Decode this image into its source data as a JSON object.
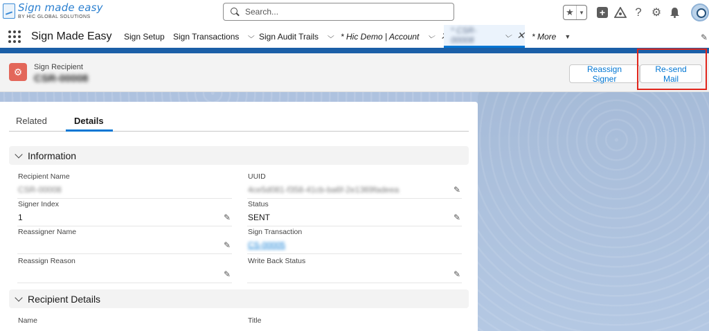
{
  "logo": {
    "title": "Sign made easy",
    "subtitle": "BY HIC GLOBAL SOLUTIONS"
  },
  "search": {
    "placeholder": "Search..."
  },
  "header_icons": [
    "favorites-star-icon",
    "favorites-dropdown-icon",
    "global-actions-plus-icon",
    "trailhead-icon",
    "help-icon",
    "setup-gear-icon",
    "notifications-bell-icon",
    "user-avatar"
  ],
  "nav": {
    "app_name": "Sign Made Easy",
    "items": [
      {
        "label": "Sign Setup"
      },
      {
        "label": "Sign Transactions"
      },
      {
        "label": "Sign Audit Trails"
      },
      {
        "label": "* Hic Demo | Account"
      },
      {
        "label": "* CSR-00008"
      },
      {
        "label": "* More"
      }
    ]
  },
  "record": {
    "type": "Sign Recipient",
    "name": "CSR-00008",
    "buttons": {
      "reassign": "Reassign Signer",
      "resend": "Re-send Mail"
    }
  },
  "tabs": {
    "related": "Related",
    "details": "Details"
  },
  "sections": {
    "information": "Information",
    "recipient_details": "Recipient Details"
  },
  "fields": {
    "recipient_name": {
      "label": "Recipient Name",
      "value": "CSR-00008"
    },
    "uuid": {
      "label": "UUID",
      "value": "4ce5d081-f358-41cb-ba6f-2e1369fadeea"
    },
    "signer_index": {
      "label": "Signer Index",
      "value": "1"
    },
    "status": {
      "label": "Status",
      "value": "SENT"
    },
    "reassigner_name": {
      "label": "Reassigner Name",
      "value": ""
    },
    "sign_transaction": {
      "label": "Sign Transaction",
      "value": "CS-00005"
    },
    "reassign_reason": {
      "label": "Reassign Reason",
      "value": ""
    },
    "write_back_status": {
      "label": "Write Back Status",
      "value": ""
    },
    "name": {
      "label": "Name",
      "value": ""
    },
    "title": {
      "label": "Title",
      "value": ""
    }
  },
  "colors": {
    "brand_blue": "#0176d3",
    "highlight_red": "#e1251b",
    "record_icon": "#e3675a",
    "strip": "#1b5fa7"
  }
}
